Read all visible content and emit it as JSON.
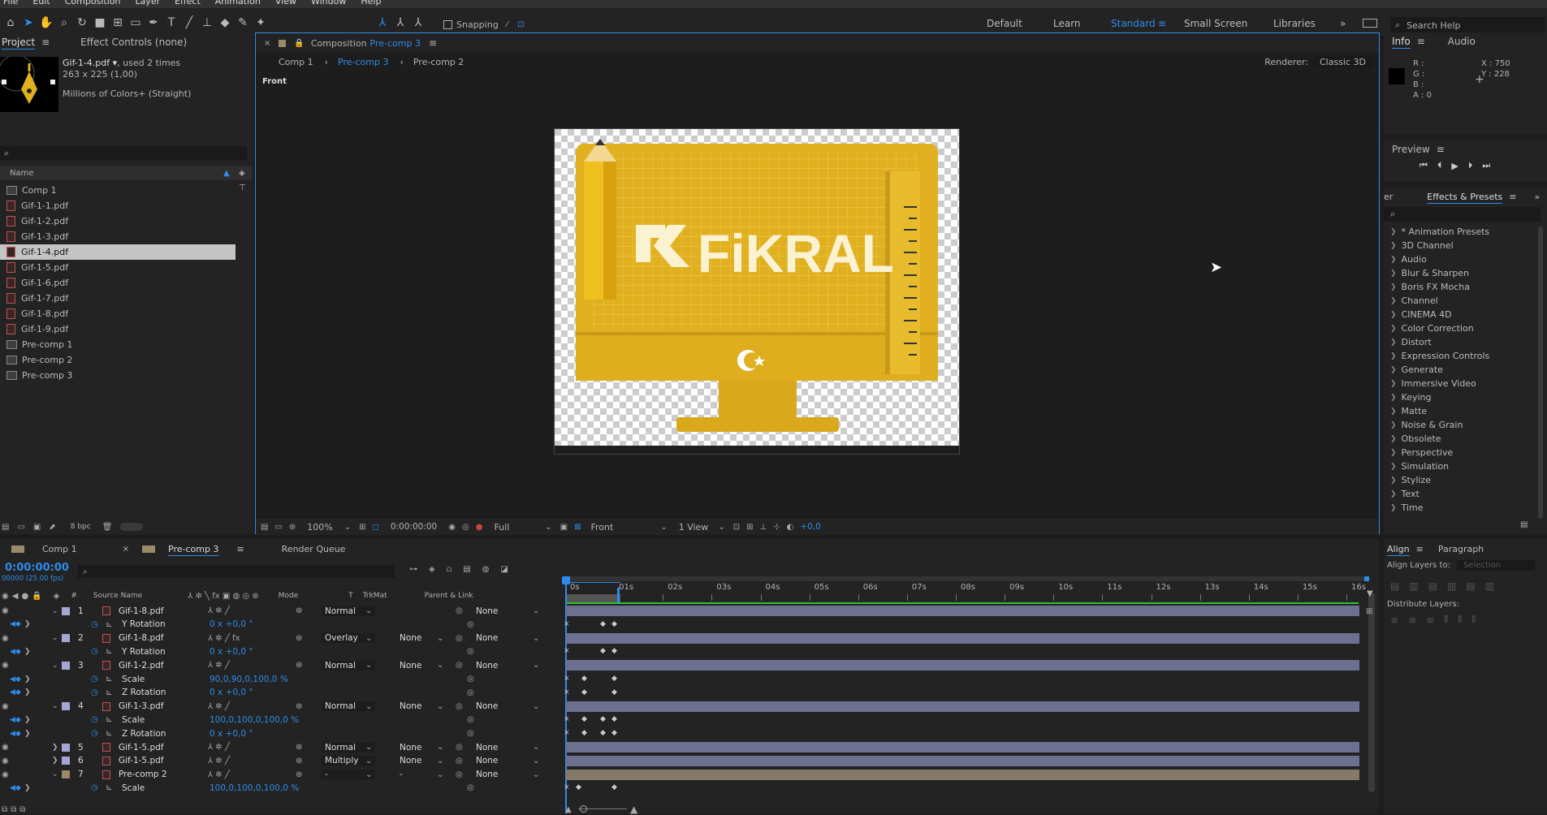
{
  "menu": [
    "File",
    "Edit",
    "Composition",
    "Layer",
    "Effect",
    "Animation",
    "View",
    "Window",
    "Help"
  ],
  "toolbar": {
    "snapping": "Snapping",
    "workspaces": [
      "Default",
      "Learn",
      "Standard",
      "Small Screen",
      "Libraries"
    ],
    "active_workspace": "Standard",
    "search_help": "Search Help"
  },
  "project": {
    "tab": "Project",
    "effect_controls": "Effect Controls (none)",
    "file_name": "Gif-1-4.pdf ▾",
    "used": ", used 2 times",
    "dims": "263 x 225 (1,00)",
    "colors": "Millions of Colors+ (Straight)",
    "col_name": "Name",
    "bpc": "8 bpc",
    "items": [
      {
        "name": "Comp 1",
        "type": "comp"
      },
      {
        "name": "Gif-1-1.pdf",
        "type": "pdf"
      },
      {
        "name": "Gif-1-2.pdf",
        "type": "pdf"
      },
      {
        "name": "Gif-1-3.pdf",
        "type": "pdf"
      },
      {
        "name": "Gif-1-4.pdf",
        "type": "pdf",
        "selected": true
      },
      {
        "name": "Gif-1-5.pdf",
        "type": "pdf"
      },
      {
        "name": "Gif-1-6.pdf",
        "type": "pdf"
      },
      {
        "name": "Gif-1-7.pdf",
        "type": "pdf"
      },
      {
        "name": "Gif-1-8.pdf",
        "type": "pdf"
      },
      {
        "name": "Gif-1-9.pdf",
        "type": "pdf"
      },
      {
        "name": "Pre-comp 1",
        "type": "comp"
      },
      {
        "name": "Pre-comp 2",
        "type": "comp"
      },
      {
        "name": "Pre-comp 3",
        "type": "comp"
      }
    ]
  },
  "composition": {
    "title_prefix": "Composition",
    "title_name": "Pre-comp 3",
    "tabs": [
      "Comp 1",
      "Pre-comp 3",
      "Pre-comp 2"
    ],
    "active_tab": "Pre-comp 3",
    "renderer_label": "Renderer:",
    "renderer": "Classic 3D",
    "view_label": "Front",
    "brand_text": "FiKRAL",
    "footer": {
      "zoom": "100%",
      "timecode": "0:00:00:00",
      "resolution": "Full",
      "view": "Front",
      "views": "1 View",
      "exposure": "+0,0"
    }
  },
  "info": {
    "tab": "Info",
    "audio": "Audio",
    "r": "R :",
    "g": "G :",
    "b": "B :",
    "a": "A : 0",
    "x": "X : 750",
    "y": "Y : 228"
  },
  "preview": {
    "tab": "Preview"
  },
  "effects": {
    "tab": "Effects & Presets",
    "prev_tab": "er",
    "items": [
      "* Animation Presets",
      "3D Channel",
      "Audio",
      "Blur & Sharpen",
      "Boris FX Mocha",
      "Channel",
      "CINEMA 4D",
      "Color Correction",
      "Distort",
      "Expression Controls",
      "Generate",
      "Immersive Video",
      "Keying",
      "Matte",
      "Noise & Grain",
      "Obsolete",
      "Perspective",
      "Simulation",
      "Stylize",
      "Text",
      "Time"
    ]
  },
  "align": {
    "tab": "Align",
    "paragraph": "Paragraph",
    "align_to_label": "Align Layers to:",
    "align_to": "Selection",
    "distribute": "Distribute Layers:"
  },
  "timeline": {
    "tabs": [
      "Comp 1",
      "Pre-comp 3",
      "Render Queue"
    ],
    "active_tab": "Pre-comp 3",
    "timecode": "0:00:00:00",
    "fps": "00000 (25.00 fps)",
    "headers": {
      "source": "Source Name",
      "mode": "Mode",
      "t": "T",
      "trkmat": "TrkMat",
      "parent": "Parent & Link"
    },
    "ruler": [
      "0s",
      "01s",
      "02s",
      "03s",
      "04s",
      "05s",
      "06s",
      "07s",
      "08s",
      "09s",
      "10s",
      "11s",
      "12s",
      "13s",
      "14s",
      "15s",
      "16s"
    ],
    "rows": [
      {
        "kind": "layer",
        "num": "1",
        "name": "Gif-1-8.pdf",
        "mode": "Normal",
        "trkmat": "",
        "parent": "None",
        "fx": false
      },
      {
        "kind": "prop",
        "name": "Y Rotation",
        "value": "0 x +0,0 °"
      },
      {
        "kind": "layer",
        "num": "2",
        "name": "Gif-1-8.pdf",
        "mode": "Overlay",
        "trkmat": "None",
        "parent": "None",
        "fx": true
      },
      {
        "kind": "prop",
        "name": "Y Rotation",
        "value": "0 x +0,0 °"
      },
      {
        "kind": "layer",
        "num": "3",
        "name": "Gif-1-2.pdf",
        "mode": "Normal",
        "trkmat": "None",
        "parent": "None",
        "fx": false
      },
      {
        "kind": "prop",
        "name": "Scale",
        "value": "90,0,90,0,100,0 %"
      },
      {
        "kind": "prop",
        "name": "Z Rotation",
        "value": "0 x +0,0 °"
      },
      {
        "kind": "layer",
        "num": "4",
        "name": "Gif-1-3.pdf",
        "mode": "Normal",
        "trkmat": "None",
        "parent": "None",
        "fx": false
      },
      {
        "kind": "prop",
        "name": "Scale",
        "value": "100,0,100,0,100,0 %"
      },
      {
        "kind": "prop",
        "name": "Z Rotation",
        "value": "0 x +0,0 °"
      },
      {
        "kind": "layer",
        "num": "5",
        "name": "Gif-1-5.pdf",
        "mode": "Normal",
        "trkmat": "None",
        "parent": "None",
        "fx": false
      },
      {
        "kind": "layer",
        "num": "6",
        "name": "Gif-1-5.pdf",
        "mode": "Multiply",
        "trkmat": "None",
        "parent": "None",
        "fx": false
      },
      {
        "kind": "layer",
        "num": "7",
        "name": "Pre-comp 2",
        "mode": "-",
        "trkmat": "-",
        "parent": "None",
        "fx": false,
        "comp": true
      },
      {
        "kind": "prop",
        "name": "Scale",
        "value": "100,0,100,0,100,0 %"
      }
    ]
  },
  "colors": {
    "accent": "#2d8ceb",
    "layer_bar": "#6d7090",
    "comp_bar": "#857a69",
    "brand_gold": "#e0b020",
    "label_lavender": "#a5a5d6"
  }
}
